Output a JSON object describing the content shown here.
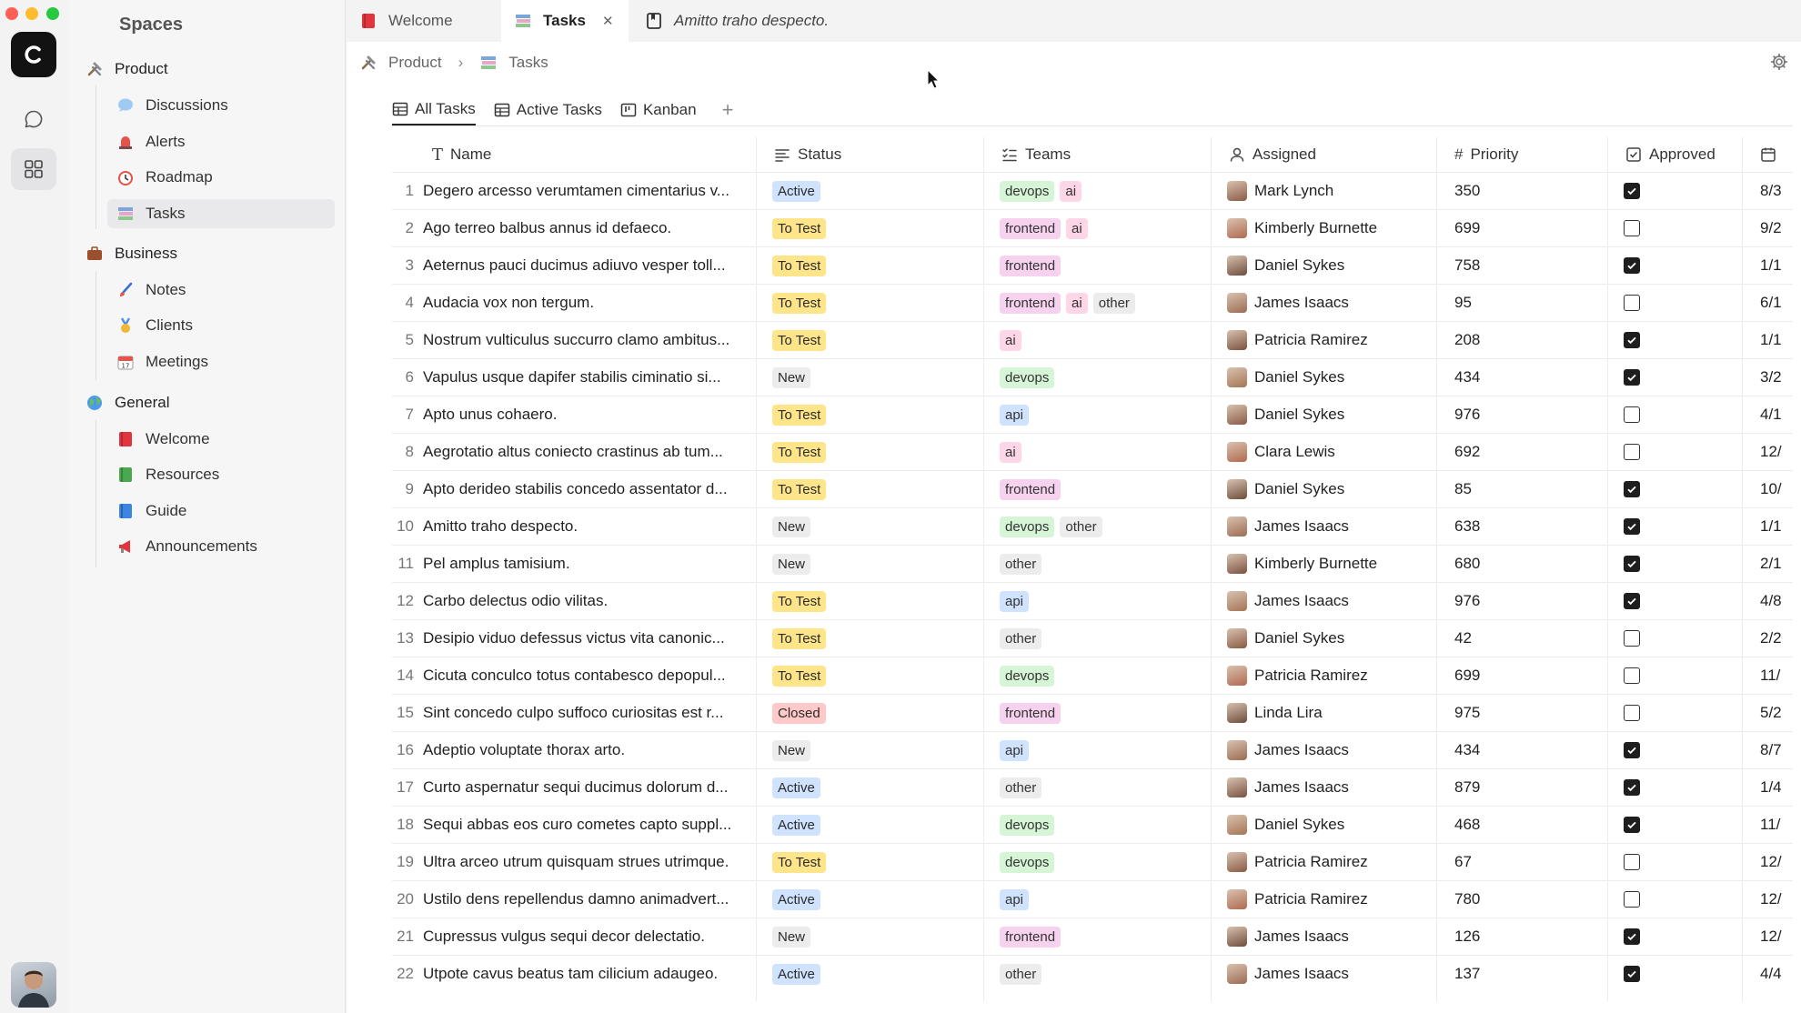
{
  "sidebar": {
    "title": "Spaces",
    "groups": [
      {
        "label": "Product",
        "icon": "hammer-wrench-icon",
        "items": [
          {
            "label": "Discussions",
            "icon": "speech-bubble-icon"
          },
          {
            "label": "Alerts",
            "icon": "alarm-light-icon"
          },
          {
            "label": "Roadmap",
            "icon": "alarm-clock-icon"
          },
          {
            "label": "Tasks",
            "icon": "books-icon",
            "active": true
          }
        ]
      },
      {
        "label": "Business",
        "icon": "briefcase-icon",
        "items": [
          {
            "label": "Notes",
            "icon": "paintbrush-icon"
          },
          {
            "label": "Clients",
            "icon": "medal-icon"
          },
          {
            "label": "Meetings",
            "icon": "calendar-icon"
          }
        ]
      },
      {
        "label": "General",
        "icon": "globe-icon",
        "items": [
          {
            "label": "Welcome",
            "icon": "red-book-icon"
          },
          {
            "label": "Resources",
            "icon": "green-book-icon"
          },
          {
            "label": "Guide",
            "icon": "blue-book-icon"
          },
          {
            "label": "Announcements",
            "icon": "megaphone-icon"
          }
        ]
      }
    ]
  },
  "tabs": [
    {
      "label": "Welcome",
      "icon": "red-book-icon"
    },
    {
      "label": "Tasks",
      "icon": "books-icon",
      "active": true,
      "close": "✕"
    },
    {
      "label": "Amitto traho despecto.",
      "icon": "note-icon"
    }
  ],
  "breadcrumb": {
    "root": "Product",
    "separator": "›",
    "current": "Tasks"
  },
  "views": [
    {
      "label": "All Tasks",
      "active": true
    },
    {
      "label": "Active Tasks"
    },
    {
      "label": "Kanban"
    }
  ],
  "add_view": "+",
  "columns": {
    "name": "Name",
    "status": "Status",
    "teams": "Teams",
    "assigned": "Assigned",
    "priority": "Priority",
    "approved": "Approved"
  },
  "colors": {
    "Active": "#cfe3ff",
    "To Test": "#ffe58a",
    "New": "#ececec",
    "Closed": "#ffc9c9",
    "devops": "#d6f5d6",
    "ai": "#ffd6e7",
    "frontend": "#f6d2ef",
    "other": "#ececec",
    "api": "#cfe3ff"
  },
  "rows": [
    {
      "n": "1",
      "name": "Degero arcesso verumtamen cimentarius v...",
      "status": "Active",
      "teams": [
        "devops",
        "ai"
      ],
      "assigned": "Mark Lynch",
      "priority": "350",
      "approved": true,
      "date": "8/3"
    },
    {
      "n": "2",
      "name": "Ago terreo balbus annus id defaeco.",
      "status": "To Test",
      "teams": [
        "frontend",
        "ai"
      ],
      "assigned": "Kimberly Burnette",
      "priority": "699",
      "approved": false,
      "date": "9/2"
    },
    {
      "n": "3",
      "name": "Aeternus pauci ducimus adiuvo vesper toll...",
      "status": "To Test",
      "teams": [
        "frontend"
      ],
      "assigned": "Daniel Sykes",
      "priority": "758",
      "approved": true,
      "date": "1/1"
    },
    {
      "n": "4",
      "name": "Audacia vox non tergum.",
      "status": "To Test",
      "teams": [
        "frontend",
        "ai",
        "other"
      ],
      "assigned": "James Isaacs",
      "priority": "95",
      "approved": false,
      "date": "6/1"
    },
    {
      "n": "5",
      "name": "Nostrum vulticulus succurro clamo ambitus...",
      "status": "To Test",
      "teams": [
        "ai"
      ],
      "assigned": "Patricia Ramirez",
      "priority": "208",
      "approved": true,
      "date": "1/1"
    },
    {
      "n": "6",
      "name": "Vapulus usque dapifer stabilis ciminatio si...",
      "status": "New",
      "teams": [
        "devops"
      ],
      "assigned": "Daniel Sykes",
      "priority": "434",
      "approved": true,
      "date": "3/2"
    },
    {
      "n": "7",
      "name": "Apto unus cohaero.",
      "status": "To Test",
      "teams": [
        "api"
      ],
      "assigned": "Daniel Sykes",
      "priority": "976",
      "approved": false,
      "date": "4/1"
    },
    {
      "n": "8",
      "name": "Aegrotatio altus coniecto crastinus ab tum...",
      "status": "To Test",
      "teams": [
        "ai"
      ],
      "assigned": "Clara Lewis",
      "priority": "692",
      "approved": false,
      "date": "12/"
    },
    {
      "n": "9",
      "name": "Apto derideo stabilis concedo assentator d...",
      "status": "To Test",
      "teams": [
        "frontend"
      ],
      "assigned": "Daniel Sykes",
      "priority": "85",
      "approved": true,
      "date": "10/"
    },
    {
      "n": "10",
      "name": "Amitto traho despecto.",
      "status": "New",
      "teams": [
        "devops",
        "other"
      ],
      "assigned": "James Isaacs",
      "priority": "638",
      "approved": true,
      "date": "1/1"
    },
    {
      "n": "11",
      "name": "Pel amplus tamisium.",
      "status": "New",
      "teams": [
        "other"
      ],
      "assigned": "Kimberly Burnette",
      "priority": "680",
      "approved": true,
      "date": "2/1"
    },
    {
      "n": "12",
      "name": "Carbo delectus odio vilitas.",
      "status": "To Test",
      "teams": [
        "api"
      ],
      "assigned": "James Isaacs",
      "priority": "976",
      "approved": true,
      "date": "4/8"
    },
    {
      "n": "13",
      "name": "Desipio viduo defessus victus vita canonic...",
      "status": "To Test",
      "teams": [
        "other"
      ],
      "assigned": "Daniel Sykes",
      "priority": "42",
      "approved": false,
      "date": "2/2"
    },
    {
      "n": "14",
      "name": "Cicuta conculco totus contabesco depopul...",
      "status": "To Test",
      "teams": [
        "devops"
      ],
      "assigned": "Patricia Ramirez",
      "priority": "699",
      "approved": false,
      "date": "11/"
    },
    {
      "n": "15",
      "name": "Sint concedo culpo suffoco curiositas est r...",
      "status": "Closed",
      "teams": [
        "frontend"
      ],
      "assigned": "Linda Lira",
      "priority": "975",
      "approved": false,
      "date": "5/2"
    },
    {
      "n": "16",
      "name": "Adeptio voluptate thorax arto.",
      "status": "New",
      "teams": [
        "api"
      ],
      "assigned": "James Isaacs",
      "priority": "434",
      "approved": true,
      "date": "8/7"
    },
    {
      "n": "17",
      "name": "Curto aspernatur sequi ducimus dolorum d...",
      "status": "Active",
      "teams": [
        "other"
      ],
      "assigned": "James Isaacs",
      "priority": "879",
      "approved": true,
      "date": "1/4"
    },
    {
      "n": "18",
      "name": "Sequi abbas eos curo cometes capto suppl...",
      "status": "Active",
      "teams": [
        "devops"
      ],
      "assigned": "Daniel Sykes",
      "priority": "468",
      "approved": true,
      "date": "11/"
    },
    {
      "n": "19",
      "name": "Ultra arceo utrum quisquam strues utrimque.",
      "status": "To Test",
      "teams": [
        "devops"
      ],
      "assigned": "Patricia Ramirez",
      "priority": "67",
      "approved": false,
      "date": "12/"
    },
    {
      "n": "20",
      "name": "Ustilo dens repellendus damno animadvert...",
      "status": "Active",
      "teams": [
        "api"
      ],
      "assigned": "Patricia Ramirez",
      "priority": "780",
      "approved": false,
      "date": "12/"
    },
    {
      "n": "21",
      "name": "Cupressus vulgus sequi decor delectatio.",
      "status": "New",
      "teams": [
        "frontend"
      ],
      "assigned": "James Isaacs",
      "priority": "126",
      "approved": true,
      "date": "12/"
    },
    {
      "n": "22",
      "name": "Utpote cavus beatus tam cilicium adaugeo.",
      "status": "Active",
      "teams": [
        "other"
      ],
      "assigned": "James Isaacs",
      "priority": "137",
      "approved": true,
      "date": "4/4"
    }
  ]
}
